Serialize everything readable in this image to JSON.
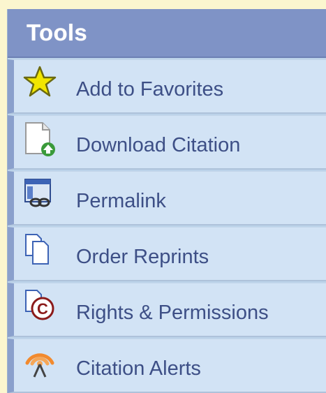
{
  "tools": {
    "title": "Tools",
    "items": [
      {
        "label": "Add to Favorites",
        "icon": "star-icon"
      },
      {
        "label": "Download Citation",
        "icon": "download-citation-icon"
      },
      {
        "label": "Permalink",
        "icon": "permalink-icon"
      },
      {
        "label": "Order Reprints",
        "icon": "reprints-icon"
      },
      {
        "label": "Rights & Permissions",
        "icon": "copyright-icon"
      },
      {
        "label": "Citation Alerts",
        "icon": "rss-alert-icon"
      }
    ]
  },
  "colors": {
    "background": "#fbf6cf",
    "header": "#7f93c6",
    "item_bg": "#d2e3f5",
    "item_accent": "#8aa0cc",
    "link_text": "#3d4f86"
  }
}
